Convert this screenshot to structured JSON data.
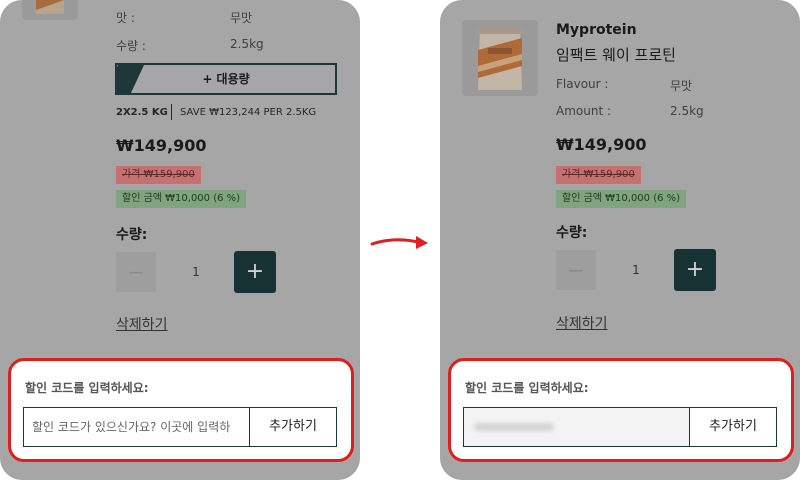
{
  "left": {
    "flavour_label": "맛 :",
    "flavour_value": "무맛",
    "amount_label": "수량 :",
    "amount_value": "2.5kg",
    "bulk_button_label": "+ 대용량",
    "bulk_info_qty": "2X2.5 KG",
    "bulk_info_save": "SAVE ₩123,244 PER 2.5KG",
    "price": "₩149,900",
    "original_price": "가격 ₩159,900",
    "discount": "할인 금액 ₩10,000 (6 %)",
    "qty_label": "수량:",
    "qty_minus": "−",
    "qty_value": "1",
    "qty_plus": "+",
    "remove_label": "삭제하기",
    "promo": {
      "title": "할인 코드를 입력하세요:",
      "placeholder": "할인 코드가 있으신가요? 이곳에 입력하",
      "add_label": "추가하기"
    }
  },
  "right": {
    "brand": "Myprotein",
    "product_name": "임팩트 웨이 프로틴",
    "flavour_label": "Flavour :",
    "flavour_value": "무맛",
    "amount_label": "Amount :",
    "amount_value": "2.5kg",
    "price": "₩149,900",
    "original_price": "가격 ₩159,900",
    "discount": "할인 금액 ₩10,000 (6 %)",
    "qty_label": "수량:",
    "qty_minus": "−",
    "qty_value": "1",
    "qty_plus": "+",
    "remove_label": "삭제하기",
    "promo": {
      "title": "할인 코드를 입력하세요:",
      "add_label": "추가하기"
    }
  },
  "colors": {
    "overlay_gray": "#a6a6a6",
    "highlight_red": "#e01e1e",
    "dark_teal": "#173232",
    "arrow_red": "#e02020"
  },
  "icons": {
    "arrow": "curved-arrow-right-icon",
    "product": "protein-pouch-image"
  }
}
